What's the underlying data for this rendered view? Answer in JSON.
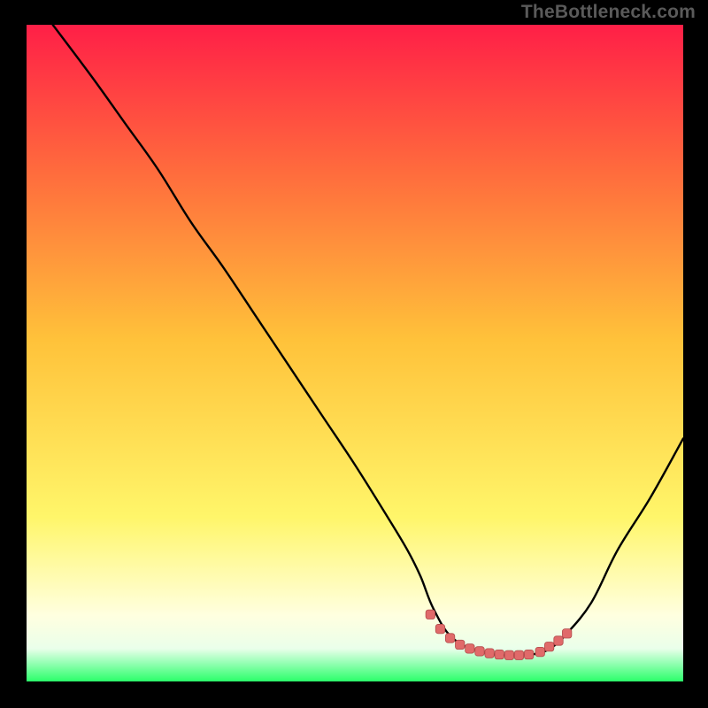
{
  "watermark": "TheBottleneck.com",
  "colors": {
    "background": "#000000",
    "watermark_text": "#5a5a5a",
    "curve_stroke": "#000000",
    "marker_fill": "#e06a6a",
    "marker_stroke": "#b24a4a",
    "gradient_top": "#ff1f47",
    "gradient_mid_upper": "#ff6a3d",
    "gradient_mid": "#ffc23a",
    "gradient_lower": "#fff66a",
    "gradient_pale": "#ffffe0",
    "gradient_green": "#2bff6a"
  },
  "chart_data": {
    "type": "line",
    "title": "",
    "xlabel": "",
    "ylabel": "",
    "xlim": [
      0,
      100
    ],
    "ylim": [
      0,
      100
    ],
    "notes": "Single black curve over vertical rainbow gradient. Curve descends steeply from top-left, reaches a flat trough (~y≈4) around x≈62–80, then rises to the right edge at ~y≈37. Pink markers sit along the trough region.",
    "series": [
      {
        "name": "bottleneck-curve",
        "x": [
          4,
          10,
          15,
          20,
          25,
          30,
          35,
          40,
          45,
          50,
          55,
          58,
          60,
          62,
          65,
          70,
          75,
          78,
          80,
          82,
          86,
          90,
          95,
          100
        ],
        "y": [
          100,
          92,
          85,
          78,
          70,
          63,
          55.5,
          48,
          40.5,
          33,
          25,
          20,
          16,
          11,
          6.5,
          4.3,
          4,
          4.3,
          5.2,
          7,
          12,
          20,
          28,
          37
        ]
      }
    ],
    "markers": {
      "name": "trough-markers",
      "x": [
        61.5,
        63,
        64.5,
        66,
        67.5,
        69,
        70.5,
        72,
        73.5,
        75,
        76.5,
        78.2,
        79.6,
        81,
        82.3
      ],
      "y": [
        10.2,
        8.0,
        6.6,
        5.6,
        5.0,
        4.6,
        4.3,
        4.1,
        4.0,
        4.0,
        4.1,
        4.5,
        5.3,
        6.2,
        7.3
      ]
    }
  }
}
